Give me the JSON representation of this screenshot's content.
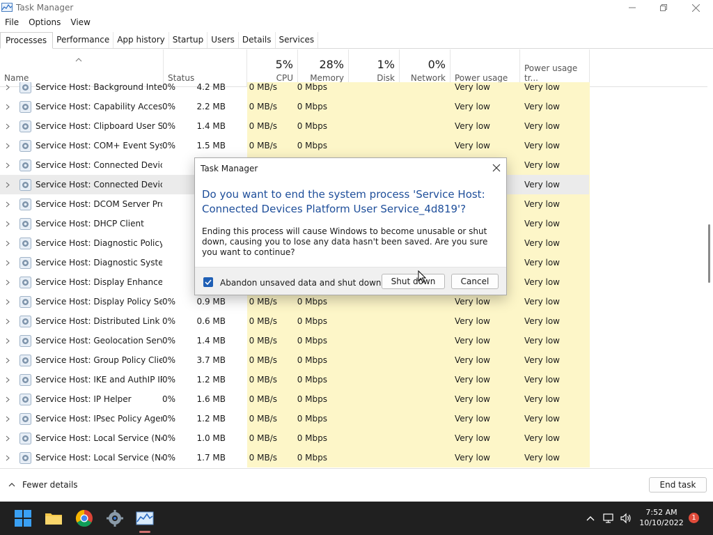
{
  "window": {
    "title": "Task Manager"
  },
  "menu": [
    "File",
    "Options",
    "View"
  ],
  "tabs": [
    "Processes",
    "Performance",
    "App history",
    "Startup",
    "Users",
    "Details",
    "Services"
  ],
  "columns": {
    "name": "Name",
    "status": "Status",
    "cpu": {
      "pct": "5%",
      "label": "CPU"
    },
    "memory": {
      "pct": "28%",
      "label": "Memory"
    },
    "disk": {
      "pct": "1%",
      "label": "Disk"
    },
    "network": {
      "pct": "0%",
      "label": "Network"
    },
    "power": "Power usage",
    "power_trend": "Power usage tr..."
  },
  "rows": [
    {
      "name": "Service Host: Background Intelli...",
      "cpu": "0%",
      "mem": "4.2 MB",
      "disk": "0 MB/s",
      "net": "0 Mbps",
      "pu": "Very low",
      "put": "Very low"
    },
    {
      "name": "Service Host: Capability Access ...",
      "cpu": "0%",
      "mem": "2.2 MB",
      "disk": "0 MB/s",
      "net": "0 Mbps",
      "pu": "Very low",
      "put": "Very low"
    },
    {
      "name": "Service Host: Clipboard User Ser...",
      "cpu": "0%",
      "mem": "1.4 MB",
      "disk": "0 MB/s",
      "net": "0 Mbps",
      "pu": "Very low",
      "put": "Very low"
    },
    {
      "name": "Service Host: COM+ Event Syste...",
      "cpu": "0%",
      "mem": "1.5 MB",
      "disk": "0 MB/s",
      "net": "0 Mbps",
      "pu": "Very low",
      "put": "Very low"
    },
    {
      "name": "Service Host: Connected Device...",
      "cpu": "",
      "mem": "",
      "disk": "",
      "net": "",
      "pu": "",
      "put": "Very low"
    },
    {
      "name": "Service Host: Connected Device...",
      "cpu": "",
      "mem": "",
      "disk": "",
      "net": "",
      "pu": "",
      "put": "Very low",
      "selected": true
    },
    {
      "name": "Service Host: DCOM Server Proc...",
      "cpu": "",
      "mem": "",
      "disk": "",
      "net": "",
      "pu": "",
      "put": "Very low"
    },
    {
      "name": "Service Host: DHCP Client",
      "cpu": "",
      "mem": "",
      "disk": "",
      "net": "",
      "pu": "",
      "put": "Very low"
    },
    {
      "name": "Service Host: Diagnostic Policy ...",
      "cpu": "",
      "mem": "",
      "disk": "",
      "net": "",
      "pu": "",
      "put": "Very low"
    },
    {
      "name": "Service Host: Diagnostic System...",
      "cpu": "",
      "mem": "",
      "disk": "",
      "net": "",
      "pu": "",
      "put": "Very low"
    },
    {
      "name": "Service Host: Display Enhancem...",
      "cpu": "",
      "mem": "",
      "disk": "",
      "net": "",
      "pu": "",
      "put": "Very low"
    },
    {
      "name": "Service Host: Display Policy Serv...",
      "cpu": "0%",
      "mem": "0.9 MB",
      "disk": "0 MB/s",
      "net": "0 Mbps",
      "pu": "Very low",
      "put": "Very low"
    },
    {
      "name": "Service Host: Distributed Link Tr...",
      "cpu": "0%",
      "mem": "0.6 MB",
      "disk": "0 MB/s",
      "net": "0 Mbps",
      "pu": "Very low",
      "put": "Very low"
    },
    {
      "name": "Service Host: Geolocation Service",
      "cpu": "0%",
      "mem": "1.4 MB",
      "disk": "0 MB/s",
      "net": "0 Mbps",
      "pu": "Very low",
      "put": "Very low"
    },
    {
      "name": "Service Host: Group Policy Client",
      "cpu": "0%",
      "mem": "3.7 MB",
      "disk": "0 MB/s",
      "net": "0 Mbps",
      "pu": "Very low",
      "put": "Very low"
    },
    {
      "name": "Service Host: IKE and AuthIP IPs...",
      "cpu": "0%",
      "mem": "1.2 MB",
      "disk": "0 MB/s",
      "net": "0 Mbps",
      "pu": "Very low",
      "put": "Very low"
    },
    {
      "name": "Service Host: IP Helper",
      "cpu": "0%",
      "mem": "1.6 MB",
      "disk": "0 MB/s",
      "net": "0 Mbps",
      "pu": "Very low",
      "put": "Very low"
    },
    {
      "name": "Service Host: IPsec Policy Agent",
      "cpu": "0%",
      "mem": "1.2 MB",
      "disk": "0 MB/s",
      "net": "0 Mbps",
      "pu": "Very low",
      "put": "Very low"
    },
    {
      "name": "Service Host: Local Service (Net...",
      "cpu": "0%",
      "mem": "1.0 MB",
      "disk": "0 MB/s",
      "net": "0 Mbps",
      "pu": "Very low",
      "put": "Very low"
    },
    {
      "name": "Service Host: Local Service (Net...",
      "cpu": "0%",
      "mem": "1.7 MB",
      "disk": "0 MB/s",
      "net": "0 Mbps",
      "pu": "Very low",
      "put": "Very low"
    }
  ],
  "footer": {
    "fewer_details": "Fewer details",
    "end_task": "End task"
  },
  "dialog": {
    "title": "Task Manager",
    "heading": "Do you want to end the system process 'Service Host: Connected Devices Platform User Service_4d819'?",
    "body": "Ending this process will cause Windows to become unusable or shut down, causing you to lose any data hasn't been saved. Are you sure you want to continue?",
    "checkbox_label": "Abandon unsaved data and shut down.",
    "checkbox_checked": true,
    "shutdown_label": "Shut down",
    "cancel_label": "Cancel"
  },
  "taskbar": {
    "time": "7:52 AM",
    "date": "10/10/2022",
    "notification_count": "1"
  },
  "colors": {
    "accent": "#1f5fb5",
    "heading": "#1e4e9a",
    "column_highlight": "#fdf6c8",
    "taskbar": "#202020"
  }
}
